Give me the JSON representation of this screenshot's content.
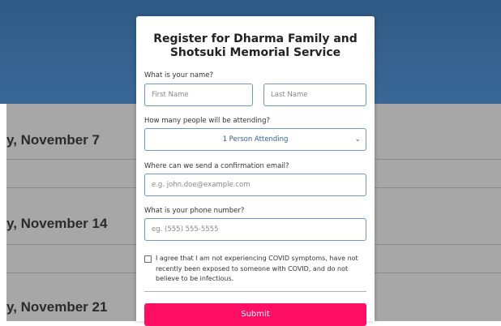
{
  "background": {
    "dates": [
      "y, November 7",
      "y, November 14",
      "y, November 21"
    ]
  },
  "modal": {
    "title": "Register for Dharma Family and Shotsuki Memorial Service",
    "name": {
      "label": "What is your name?",
      "first_placeholder": "First Name",
      "last_placeholder": "Last Name"
    },
    "attendees": {
      "label": "How many people will be attending?",
      "selected": "1 Person Attending"
    },
    "email": {
      "label": "Where can we send a confirmation email?",
      "placeholder": "e.g. john.doe@example.com"
    },
    "phone": {
      "label": "What is your phone number?",
      "placeholder": "eg. (555) 555-5555"
    },
    "consent_text": "I agree that I am not experiencing COVID symptoms, have not recently been exposed to someone with COVID, and do not believe to be infectious.",
    "submit_label": "Submit"
  },
  "colors": {
    "header": "#2f5a86",
    "backdrop": "#a7a7a7",
    "accent": "#ff0f63",
    "input_border": "#6b98c4"
  }
}
